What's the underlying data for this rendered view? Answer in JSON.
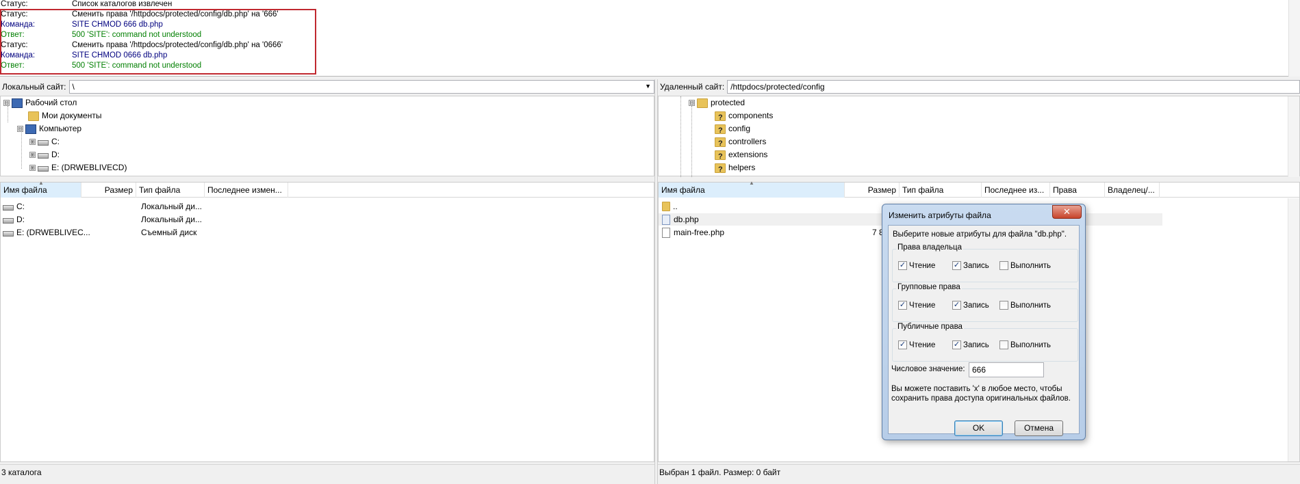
{
  "log": [
    {
      "label": "Статус:",
      "text": "Список каталогов извлечен",
      "kind": "status"
    },
    {
      "label": "Статус:",
      "text": "Сменить права '/httpdocs/protected/config/db.php' на '666'",
      "kind": "status"
    },
    {
      "label": "Команда:",
      "text": "SITE CHMOD 666 db.php",
      "kind": "command"
    },
    {
      "label": "Ответ:",
      "text": "500 'SITE': command not understood",
      "kind": "response"
    },
    {
      "label": "Статус:",
      "text": "Сменить права '/httpdocs/protected/config/db.php' на '0666'",
      "kind": "status"
    },
    {
      "label": "Команда:",
      "text": "SITE CHMOD 0666 db.php",
      "kind": "command"
    },
    {
      "label": "Ответ:",
      "text": "500 'SITE': command not understood",
      "kind": "response"
    }
  ],
  "local": {
    "site_label": "Локальный сайт:",
    "site_path": "\\",
    "tree": [
      {
        "label": "Рабочий стол",
        "icon": "desktop-icon",
        "expander": "⊟"
      },
      {
        "label": "Мои документы",
        "icon": "folder-icon",
        "expander": ""
      },
      {
        "label": "Компьютер",
        "icon": "computer-icon",
        "expander": "⊟"
      },
      {
        "label": "C:",
        "icon": "drive-icon",
        "expander": "⊞"
      },
      {
        "label": "D:",
        "icon": "drive-icon",
        "expander": "⊞"
      },
      {
        "label": "E: (DRWEBLIVECD)",
        "icon": "cd-drive-icon",
        "expander": "⊞"
      }
    ],
    "columns": [
      "Имя файла",
      "Размер",
      "Тип файла",
      "Последнее измен..."
    ],
    "files": [
      {
        "name": "C:",
        "size": "",
        "type": "Локальный ди..."
      },
      {
        "name": "D:",
        "size": "",
        "type": "Локальный ди..."
      },
      {
        "name": "E: (DRWEBLIVEC...",
        "size": "",
        "type": "Съемный диск"
      }
    ],
    "status": "3 каталога"
  },
  "remote": {
    "site_label": "Удаленный сайт:",
    "site_path": "/httpdocs/protected/config",
    "tree": [
      {
        "label": "protected",
        "icon": "folder-icon",
        "expander": "⊟"
      },
      {
        "label": "components",
        "icon": "unknown-folder-icon",
        "expander": ""
      },
      {
        "label": "config",
        "icon": "unknown-folder-icon",
        "expander": ""
      },
      {
        "label": "controllers",
        "icon": "unknown-folder-icon",
        "expander": ""
      },
      {
        "label": "extensions",
        "icon": "unknown-folder-icon",
        "expander": ""
      },
      {
        "label": "helpers",
        "icon": "unknown-folder-icon",
        "expander": ""
      }
    ],
    "columns": [
      "Имя файла",
      "Размер",
      "Тип файла",
      "Последнее из...",
      "Права",
      "Владелец/..."
    ],
    "files": [
      {
        "name": "..",
        "size": "",
        "icon": "folder-icon"
      },
      {
        "name": "db.php",
        "size": "",
        "icon": "php-file-icon"
      },
      {
        "name": "main-free.php",
        "size": "7 8",
        "icon": "file-icon"
      }
    ],
    "status": "Выбран 1 файл. Размер: 0 байт"
  },
  "dialog": {
    "title": "Изменить атрибуты файла",
    "close": "✕",
    "prompt": "Выберите новые атрибуты для файла \"db.php\".",
    "groups": [
      {
        "title": "Права владельца",
        "read": "Чтение",
        "write": "Запись",
        "exec": "Выполнить",
        "read_checked": true,
        "write_checked": true,
        "exec_checked": false
      },
      {
        "title": "Групповые права",
        "read": "Чтение",
        "write": "Запись",
        "exec": "Выполнить",
        "read_checked": true,
        "write_checked": true,
        "exec_checked": false
      },
      {
        "title": "Публичные права",
        "read": "Чтение",
        "write": "Запись",
        "exec": "Выполнить",
        "read_checked": true,
        "write_checked": true,
        "exec_checked": false
      }
    ],
    "numeric_label": "Числовое значение:",
    "numeric_value": "666",
    "hint_line1": "Вы можете поставить 'x' в любое место, чтобы",
    "hint_line2": "сохранить права доступа оригинальных файлов.",
    "ok": "OK",
    "cancel": "Отмена",
    "check_mark": "✓"
  }
}
